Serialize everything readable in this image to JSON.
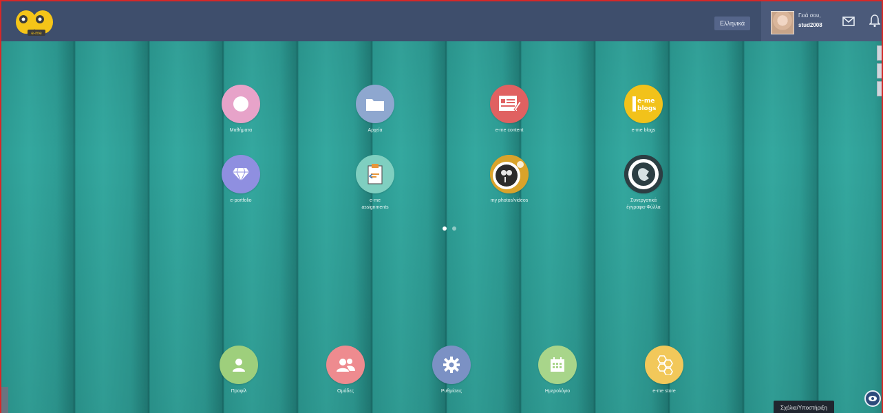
{
  "topbar": {
    "language_label": "Ελληνικά",
    "greeting": "Γειά σου,",
    "username": "stud2008"
  },
  "apps_row1": [
    {
      "label": "Μαθήματα",
      "icon": "circle-icon",
      "color": "#e7a3c9"
    },
    {
      "label": "Αρχεία",
      "icon": "folder-icon",
      "color": "#8ea7cf"
    },
    {
      "label": "e-me content",
      "icon": "content-editor-icon",
      "color": "#e06161"
    },
    {
      "label": "e-me blogs",
      "icon": "blogs-icon",
      "color": "#f2c21a"
    }
  ],
  "apps_row2": [
    {
      "label": "e-portfolio",
      "icon": "diamond-icon",
      "color": "#8f8fe0"
    },
    {
      "label": "e-me\nassignments",
      "icon": "clipboard-icon",
      "color": "#7fcfc0"
    },
    {
      "label": "my photos/videos",
      "icon": "photos-icon",
      "color": "#2b2b2b"
    },
    {
      "label": "Συνεργατικά\nέγγραφα-Φύλλα",
      "icon": "collab-docs-icon",
      "color": "#2c3e43"
    }
  ],
  "dock": [
    {
      "label": "Προφίλ",
      "icon": "user-icon",
      "color": "#9ecf7c"
    },
    {
      "label": "Ομάδες",
      "icon": "group-icon",
      "color": "#ee8b8f"
    },
    {
      "label": "Ρυθμίσεις",
      "icon": "gear-icon",
      "color": "#7b91c4"
    },
    {
      "label": "Ημερολόγιο",
      "icon": "calendar-icon",
      "color": "#a8d58a"
    },
    {
      "label": "e-me store",
      "icon": "hive-icon",
      "color": "#f2c85a"
    }
  ],
  "pagination": {
    "pages": 2,
    "active": 1
  },
  "footer": {
    "admin_panel_label": "Σχόλια/Υποστήριξη"
  },
  "colors": {
    "topbar": "#3e4e6c",
    "accent_border": "#d62828",
    "background": "#2f8f8a"
  }
}
